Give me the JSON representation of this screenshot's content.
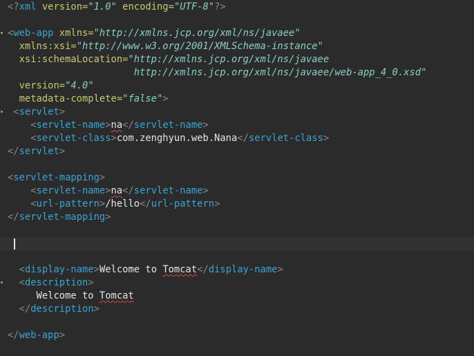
{
  "editor": {
    "language": "xml",
    "lines": [
      [
        {
          "c": "tag-br",
          "t": "<?"
        },
        {
          "c": "pi",
          "t": "xml"
        },
        {
          "c": "attr-name",
          "t": " version="
        },
        {
          "c": "attr-val",
          "t": "\"1.0\""
        },
        {
          "c": "attr-name",
          "t": " encoding="
        },
        {
          "c": "attr-val",
          "t": "\"UTF-8\""
        },
        {
          "c": "tag-br",
          "t": "?>"
        }
      ],
      [],
      [
        {
          "c": "tag-br",
          "t": "<"
        },
        {
          "c": "tag-name",
          "t": "web-app"
        },
        {
          "c": "attr-name",
          "t": " xmlns="
        },
        {
          "c": "attr-val",
          "t": "\"http://xmlns.jcp.org/xml/ns/javaee\""
        }
      ],
      [
        {
          "c": "attr-name",
          "t": "  xmlns:xsi="
        },
        {
          "c": "attr-val",
          "t": "\"http://www.w3.org/2001/XMLSchema-instance\""
        }
      ],
      [
        {
          "c": "attr-name",
          "t": "  xsi:schemaLocation="
        },
        {
          "c": "attr-val",
          "t": "\"http://xmlns.jcp.org/xml/ns/javaee"
        }
      ],
      [
        {
          "c": "attr-val",
          "t": "                      http://xmlns.jcp.org/xml/ns/javaee/web-app_4_0.xsd\""
        }
      ],
      [
        {
          "c": "attr-name",
          "t": "  version="
        },
        {
          "c": "attr-val",
          "t": "\"4.0\""
        }
      ],
      [
        {
          "c": "attr-name",
          "t": "  metadata-complete="
        },
        {
          "c": "attr-val",
          "t": "\"false\""
        },
        {
          "c": "tag-br",
          "t": ">"
        }
      ],
      [
        {
          "c": "tag-br",
          "t": " <"
        },
        {
          "c": "tag-name",
          "t": "servlet"
        },
        {
          "c": "tag-br",
          "t": ">"
        }
      ],
      [
        {
          "c": "text",
          "t": "    "
        },
        {
          "c": "tag-br",
          "t": "<"
        },
        {
          "c": "tag-name",
          "t": "servlet-name"
        },
        {
          "c": "tag-br",
          "t": ">"
        },
        {
          "c": "text spell",
          "t": "na"
        },
        {
          "c": "tag-br",
          "t": "</"
        },
        {
          "c": "tag-name",
          "t": "servlet-name"
        },
        {
          "c": "tag-br",
          "t": ">"
        }
      ],
      [
        {
          "c": "text",
          "t": "    "
        },
        {
          "c": "tag-br",
          "t": "<"
        },
        {
          "c": "tag-name",
          "t": "servlet-class"
        },
        {
          "c": "tag-br",
          "t": ">"
        },
        {
          "c": "text",
          "t": "com.zenghyun.web.Nana"
        },
        {
          "c": "tag-br",
          "t": "</"
        },
        {
          "c": "tag-name",
          "t": "servlet-class"
        },
        {
          "c": "tag-br",
          "t": ">"
        }
      ],
      [
        {
          "c": "tag-br",
          "t": "</"
        },
        {
          "c": "tag-name",
          "t": "servlet"
        },
        {
          "c": "tag-br",
          "t": ">"
        }
      ],
      [],
      [
        {
          "c": "tag-br",
          "t": "<"
        },
        {
          "c": "tag-name",
          "t": "servlet-mapping"
        },
        {
          "c": "tag-br",
          "t": ">"
        }
      ],
      [
        {
          "c": "text",
          "t": "    "
        },
        {
          "c": "tag-br",
          "t": "<"
        },
        {
          "c": "tag-name",
          "t": "servlet-name"
        },
        {
          "c": "tag-br",
          "t": ">"
        },
        {
          "c": "text spell",
          "t": "na"
        },
        {
          "c": "tag-br",
          "t": "</"
        },
        {
          "c": "tag-name",
          "t": "servlet-name"
        },
        {
          "c": "tag-br",
          "t": ">"
        }
      ],
      [
        {
          "c": "text",
          "t": "    "
        },
        {
          "c": "tag-br",
          "t": "<"
        },
        {
          "c": "tag-name",
          "t": "url-pattern"
        },
        {
          "c": "tag-br",
          "t": ">"
        },
        {
          "c": "text",
          "t": "/hello"
        },
        {
          "c": "tag-br",
          "t": "</"
        },
        {
          "c": "tag-name",
          "t": "url-pattern"
        },
        {
          "c": "tag-br",
          "t": ">"
        }
      ],
      [
        {
          "c": "tag-br",
          "t": "</"
        },
        {
          "c": "tag-name",
          "t": "servlet-mapping"
        },
        {
          "c": "tag-br",
          "t": ">"
        }
      ],
      [],
      [],
      [],
      [
        {
          "c": "text",
          "t": "  "
        },
        {
          "c": "tag-br",
          "t": "<"
        },
        {
          "c": "tag-name",
          "t": "display-name"
        },
        {
          "c": "tag-br",
          "t": ">"
        },
        {
          "c": "text",
          "t": "Welcome to "
        },
        {
          "c": "text spell",
          "t": "Tomcat"
        },
        {
          "c": "tag-br",
          "t": "</"
        },
        {
          "c": "tag-name",
          "t": "display-name"
        },
        {
          "c": "tag-br",
          "t": ">"
        }
      ],
      [
        {
          "c": "text",
          "t": "  "
        },
        {
          "c": "tag-br",
          "t": "<"
        },
        {
          "c": "tag-name",
          "t": "description"
        },
        {
          "c": "tag-br",
          "t": ">"
        }
      ],
      [
        {
          "c": "text",
          "t": "     Welcome to "
        },
        {
          "c": "text spell",
          "t": "Tomcat"
        }
      ],
      [
        {
          "c": "text",
          "t": "  "
        },
        {
          "c": "tag-br",
          "t": "</"
        },
        {
          "c": "tag-name",
          "t": "description"
        },
        {
          "c": "tag-br",
          "t": ">"
        }
      ],
      [],
      [
        {
          "c": "tag-br",
          "t": "</"
        },
        {
          "c": "tag-name",
          "t": "web-app"
        },
        {
          "c": "tag-br",
          "t": ">"
        }
      ]
    ],
    "fold_marker_lines": [
      2,
      8,
      21
    ],
    "current_line_index": 18
  }
}
